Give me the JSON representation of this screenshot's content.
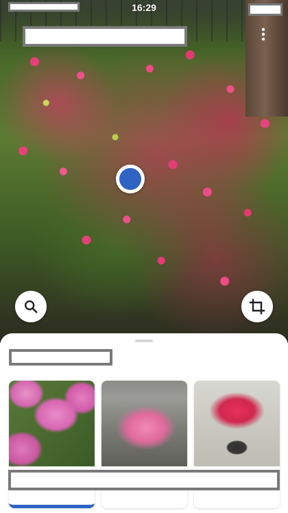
{
  "status_bar": {
    "time": "16:29"
  },
  "top_bar": {
    "more_icon": "more-vertical-icon"
  },
  "focus": {
    "accent_color": "#2f63c4"
  },
  "actions": {
    "search_icon": "search-icon",
    "crop_icon": "crop-icon"
  },
  "sheet": {
    "results": [
      {
        "image": "azalea-closeup"
      },
      {
        "image": "pink-flower-bush"
      },
      {
        "image": "potted-red-azalea"
      }
    ],
    "selected_indicator_color": "#2f63c4"
  }
}
